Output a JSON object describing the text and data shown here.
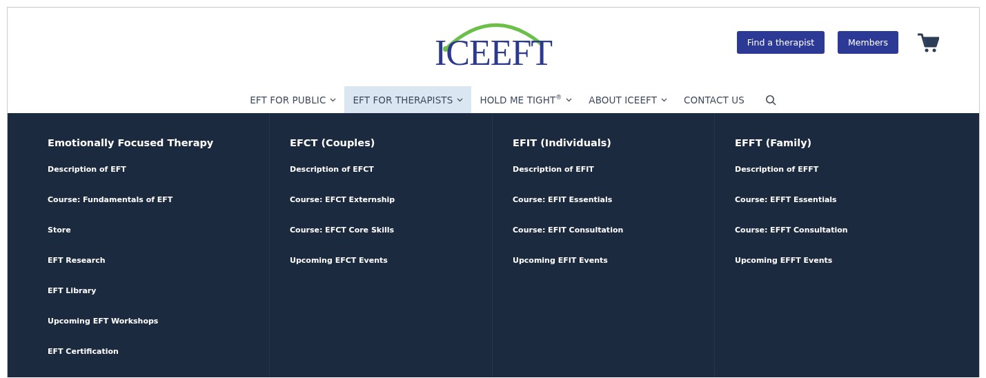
{
  "logo": {
    "text": "ICEEFT"
  },
  "header_buttons": [
    "Find a therapist",
    "Members"
  ],
  "nav": [
    {
      "label": "EFT FOR PUBLIC",
      "has_dropdown": true,
      "selected": false
    },
    {
      "label": "EFT FOR THERAPISTS",
      "has_dropdown": true,
      "selected": true
    },
    {
      "label": "HOLD ME TIGHT$^{®}$",
      "has_dropdown": true,
      "selected": false
    },
    {
      "label": "ABOUT ICEEFT",
      "has_dropdown": true,
      "selected": false
    },
    {
      "label": "CONTACT US",
      "has_dropdown": false,
      "selected": false
    }
  ],
  "mega_menu": [
    {
      "heading": "Emotionally Focused Therapy",
      "links": [
        "Description of EFT",
        "Course: Fundamentals of EFT",
        "Store",
        "EFT Research",
        "EFT Library",
        "Upcoming EFT Workshops",
        "EFT Certification"
      ]
    },
    {
      "heading": "EFCT (Couples)",
      "links": [
        "Description of EFCT",
        "Course: EFCT Externship",
        "Course: EFCT Core Skills",
        "Upcoming EFCT Events"
      ]
    },
    {
      "heading": "EFIT (Individuals)",
      "links": [
        "Description of EFIT",
        "Course: EFIT Essentials",
        "Course: EFIT Consultation",
        "Upcoming EFIT Events"
      ]
    },
    {
      "heading": "EFFT (Family)",
      "links": [
        "Description of EFFT",
        "Course: EFFT Essentials",
        "Course: EFFT Consultation",
        "Upcoming EFFT Events"
      ]
    }
  ]
}
